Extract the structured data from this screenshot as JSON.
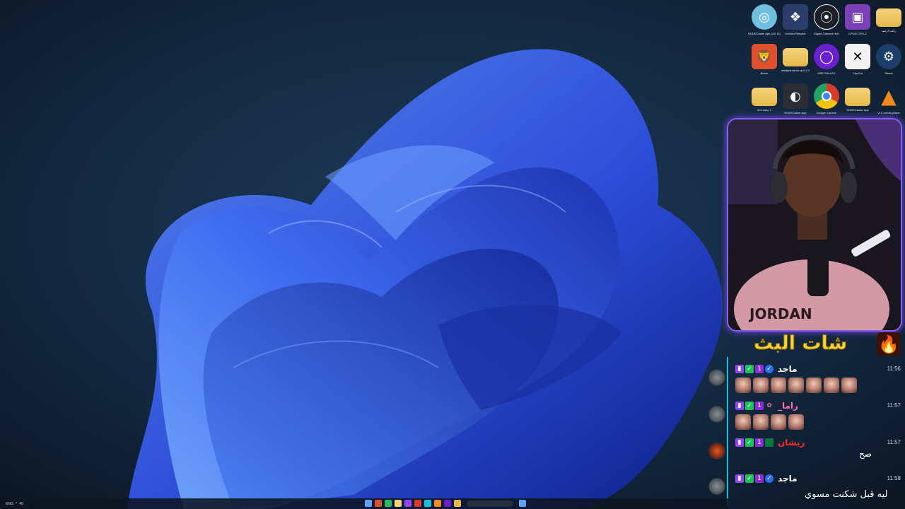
{
  "desktop": {
    "icons": [
      {
        "name": "RODECaster App (3.0.11)",
        "icon": "disc-icon",
        "color": "#6fc0e0"
      },
      {
        "name": "DaVinci Resolve",
        "icon": "davinci-icon",
        "color": "#2b3d6b"
      },
      {
        "name": "Elgato Camera Hub",
        "icon": "camera-icon",
        "color": "#1c1f26"
      },
      {
        "name": "CPUID CPU-Z",
        "icon": "cpu-icon",
        "color": "#7b3fb8"
      },
      {
        "name": "راشد الرشيد",
        "icon": "user-folder-icon",
        "color": "#e8c35c"
      },
      {
        "name": "Brave",
        "icon": "brave-icon",
        "color": "#e0502a"
      },
      {
        "name": "wlsdjwd-windr-qt-0.4.0",
        "icon": "folder-icon",
        "color": "#e5b84a"
      },
      {
        "name": "OBS GALAXY",
        "icon": "obs-icon",
        "color": "#6a1fd0"
      },
      {
        "name": "CapCut",
        "icon": "capcut-icon",
        "color": "#f2f2f2"
      },
      {
        "name": "Steam",
        "icon": "steam-icon",
        "color": "#1b3d6b"
      },
      {
        "name": "kira easy 1",
        "icon": "folder-icon",
        "color": "#e5b84a"
      },
      {
        "name": "RODECaster App",
        "icon": "rode-icon",
        "color": "#2a2d33"
      },
      {
        "name": "Google Chrome",
        "icon": "chrome-icon",
        "color": "#d93b2b"
      },
      {
        "name": "RODECaster App",
        "icon": "folder-icon",
        "color": "#e5b84a"
      },
      {
        "name": "VLC media player",
        "icon": "vlc-icon",
        "color": "#f08a1a"
      }
    ]
  },
  "webcam": {
    "label": "JORDAN"
  },
  "chat": {
    "title": "شات البث",
    "title_icon": "fire-icon",
    "accent": "#13c2d6",
    "messages": [
      {
        "user": "ماجد",
        "user_color": "#ffffff",
        "time": "11:56",
        "badges": [
          "twitch",
          "sub",
          "1",
          "vip"
        ],
        "emotes": 7,
        "text": ""
      },
      {
        "user": "راما_",
        "user_color": "#ff6fb1",
        "time": "11:57",
        "badges": [
          "twitch",
          "sub",
          "1",
          "flower"
        ],
        "emotes": 4,
        "text": ""
      },
      {
        "user": "ريشان",
        "user_color": "#ff2a2a",
        "time": "11:57",
        "badges": [
          "twitch",
          "sub",
          "1",
          "flag"
        ],
        "emotes": 0,
        "text": "صح"
      },
      {
        "user": "ماجد",
        "user_color": "#ffffff",
        "time": "11:58",
        "badges": [
          "twitch",
          "sub",
          "1",
          "vip"
        ],
        "emotes": 0,
        "text": ""
      }
    ],
    "bottom_text": "ليه قبل شكنت مسوي"
  },
  "taskbar": {
    "tray_items": [
      "ENG",
      "^",
      "40"
    ],
    "app_icon_colors": [
      "#5aa0ff",
      "#e0502a",
      "#1fc15a",
      "#f4d37a",
      "#9146ff",
      "#d93b2b",
      "#13c2d6",
      "#f08a1a",
      "#6a1fd0",
      "#e5b84a",
      "#5aa0ff",
      "#ffffff",
      "#2b3d6b"
    ]
  }
}
